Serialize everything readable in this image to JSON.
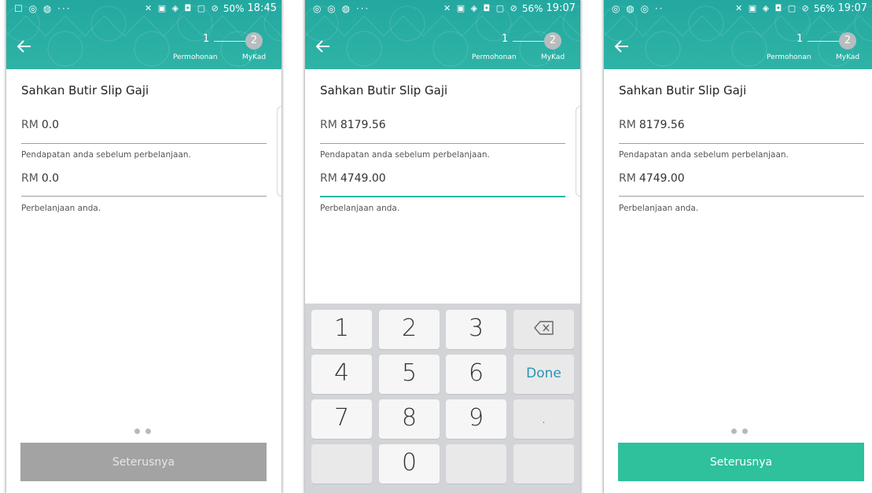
{
  "status_bars": [
    {
      "left_icons": "☐ ◎ ◍ ···",
      "right_icons": "✕ ▣ ◈ ◘ ▢ ⊘",
      "battery": "50%",
      "time": "18:45"
    },
    {
      "left_icons": "◎ ◎ ◍ ···",
      "right_icons": "✕ ▣ ◈ ◘ ▢ ⊘",
      "battery": "56%",
      "time": "19:07"
    },
    {
      "left_icons": "◎ ◍ ◎ ··",
      "right_icons": "✕ ▣ ◈ ◘ ▢ ⊘",
      "battery": "56%",
      "time": "19:07"
    }
  ],
  "appbar": {
    "back_icon": "arrow-left-icon",
    "step1_number": "1",
    "step1_label": "Permohonan",
    "step2_number": "2",
    "step2_label": "MyKad",
    "background_color": "#2aa99f"
  },
  "screens": [
    {
      "title": "Sahkan Butir Slip Gaji",
      "income": {
        "prefix": "RM",
        "value": "0.0",
        "hint": "Pendapatan anda sebelum perbelanjaan."
      },
      "expense": {
        "prefix": "RM",
        "value": "0.0",
        "hint": "Perbelanjaan anda."
      },
      "next_button": "Seterusnya"
    },
    {
      "title": "Sahkan Butir Slip Gaji",
      "income": {
        "prefix": "RM",
        "value": "8179.56",
        "hint": "Pendapatan anda sebelum perbelanjaan."
      },
      "expense": {
        "prefix": "RM",
        "value": "4749.00",
        "hint": "Perbelanjaan anda."
      }
    },
    {
      "title": "Sahkan Butir Slip Gaji",
      "income": {
        "prefix": "RM",
        "value": "8179.56",
        "hint": "Pendapatan anda sebelum perbelanjaan."
      },
      "expense": {
        "prefix": "RM",
        "value": "4749.00",
        "hint": "Perbelanjaan anda."
      },
      "next_button": "Seterusnya"
    }
  ],
  "keypad": {
    "keys": [
      "1",
      "2",
      "3",
      "4",
      "5",
      "6",
      "7",
      "8",
      "9",
      "0"
    ],
    "done": "Done",
    "decimal": ".",
    "backspace_icon": "backspace-icon"
  },
  "colors": {
    "accent": "#2bb3a5",
    "button_enabled": "#2ec19b",
    "button_disabled": "#a3a3a3",
    "done_text": "#2a93b9"
  }
}
